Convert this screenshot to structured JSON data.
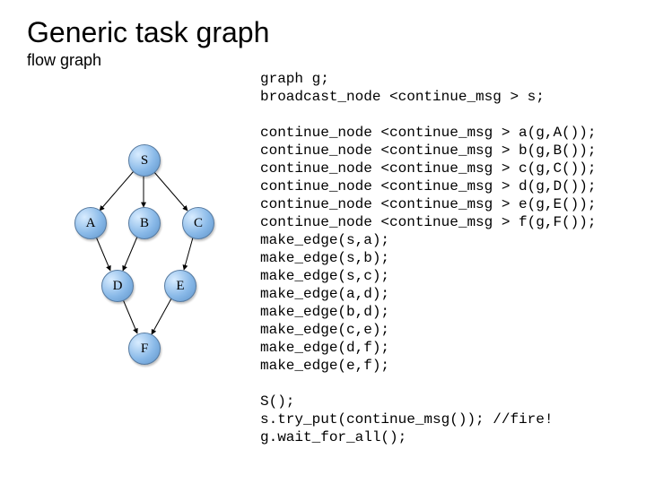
{
  "title": "Generic task graph",
  "subtitle": "flow graph",
  "graph": {
    "nodes": {
      "S": "S",
      "A": "A",
      "B": "B",
      "C": "C",
      "D": "D",
      "E": "E",
      "F": "F"
    }
  },
  "code": {
    "block1": "graph g;\nbroadcast_node <continue_msg > s;",
    "block2": "continue_node <continue_msg > a(g,A());\ncontinue_node <continue_msg > b(g,B());\ncontinue_node <continue_msg > c(g,C());\ncontinue_node <continue_msg > d(g,D());\ncontinue_node <continue_msg > e(g,E());\ncontinue_node <continue_msg > f(g,F());\nmake_edge(s,a);\nmake_edge(s,b);\nmake_edge(s,c);\nmake_edge(a,d);\nmake_edge(b,d);\nmake_edge(c,e);\nmake_edge(d,f);\nmake_edge(e,f);",
    "block3": "S();\ns.try_put(continue_msg()); //fire!\ng.wait_for_all();"
  }
}
